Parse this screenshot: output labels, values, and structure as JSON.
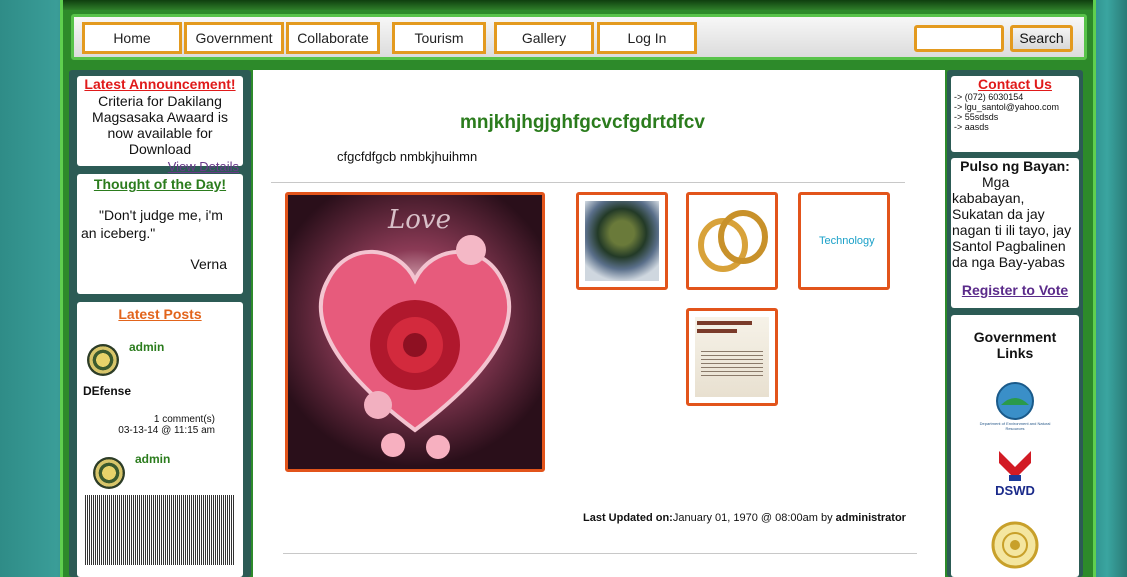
{
  "nav": {
    "items": [
      "Home",
      "Government",
      "Collaborate",
      "Tourism",
      "Gallery",
      "Log In"
    ],
    "search_placeholder": "",
    "search_button": "Search"
  },
  "left": {
    "announcement": {
      "title": "Latest Announcement!",
      "text": "Criteria for Dakilang Magsasaka Awaard is now available for Download",
      "link": "View Details"
    },
    "thought": {
      "title": "Thought of the Day!",
      "quote": "\"Don't judge me, i'm an iceberg.\"",
      "author": "Verna"
    },
    "posts": {
      "title": "Latest Posts",
      "items": [
        {
          "author": "admin",
          "title": "DEfense",
          "comments": "1 comment(s)",
          "date": "03-13-14 @ 11:15 am"
        },
        {
          "author": "admin"
        }
      ]
    }
  },
  "main": {
    "title": "mnjkhjhgjghfgcvcfgdrtdfcv",
    "subtitle": "cfgcfdfgcb nmbkjhuihmn",
    "featured_image_text": "Love",
    "thumb_tech_text": "Technology",
    "updated_label": "Last Updated on:",
    "updated_value": "January 01, 1970 @ 08:00am by ",
    "updated_by": "administrator"
  },
  "right": {
    "contact": {
      "title": "Contact Us",
      "lines": [
        "-> (072) 6030154",
        "-> lgu_santol@yahoo.com",
        "-> 55sdsds",
        "-> aasds"
      ]
    },
    "pulso": {
      "title": "Pulso ng Bayan:",
      "text": "Mga kababayan, Sukatan da jay nagan ti ili tayo, jay Santol Pagbalinen da nga Bay-yabas",
      "link": "Register to Vote"
    },
    "gov_links": {
      "title": "Government Links",
      "denr_caption": "Department of Environment and Natural Resources",
      "dswd_caption": "DSWD"
    }
  },
  "colors": {
    "accent_orange": "#e39a1f",
    "thumb_border": "#e2541b",
    "title_green": "#2b7c1d",
    "frame_green": "#2d8a2a"
  }
}
